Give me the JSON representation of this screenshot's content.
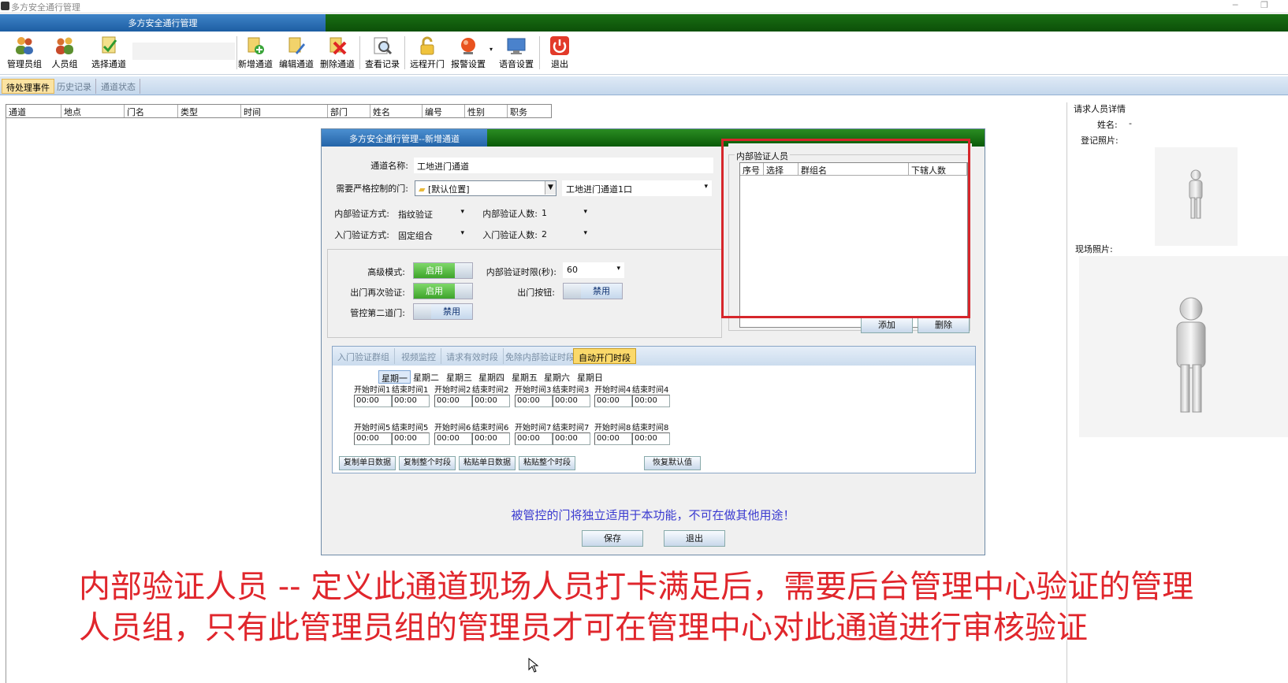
{
  "window": {
    "title": "多方安全通行管理",
    "banner_title": "多方安全通行管理"
  },
  "toolbar": {
    "items": [
      {
        "label": "管理员组",
        "icon": "admin-group-icon"
      },
      {
        "label": "人员组",
        "icon": "people-group-icon"
      },
      {
        "label": "选择通道",
        "icon": "select-channel-icon"
      },
      {
        "label": "新增通道",
        "icon": "add-channel-icon"
      },
      {
        "label": "编辑通道",
        "icon": "edit-channel-icon"
      },
      {
        "label": "删除通道",
        "icon": "delete-channel-icon"
      },
      {
        "label": "查看记录",
        "icon": "view-records-icon"
      },
      {
        "label": "远程开门",
        "icon": "remote-open-icon"
      },
      {
        "label": "报警设置",
        "icon": "alarm-settings-icon"
      },
      {
        "label": "语音设置",
        "icon": "voice-settings-icon"
      },
      {
        "label": "退出",
        "icon": "power-icon"
      }
    ]
  },
  "main_tabs": [
    "待处理事件",
    "历史记录",
    "通道状态"
  ],
  "grid": {
    "columns": [
      "通道",
      "地点",
      "门名",
      "类型",
      "时间",
      "部门",
      "姓名",
      "编号",
      "性别",
      "职务"
    ]
  },
  "right_panel": {
    "title": "请求人员详情",
    "name_label": "姓名:",
    "name_value": "-",
    "reg_photo_label": "登记照片:",
    "scene_photo_label": "现场照片:"
  },
  "dialog": {
    "title": "多方安全通行管理--新增通道",
    "channel_name_label": "通道名称:",
    "channel_name_value": "工地进门通道",
    "door_label": "需要严格控制的门:",
    "door_location": "[默认位置]",
    "door_name": "工地进门通道1口",
    "internal_method_label": "内部验证方式:",
    "internal_method_value": "指纹验证",
    "internal_count_label": "内部验证人数:",
    "internal_count_value": "1",
    "entry_method_label": "入门验证方式:",
    "entry_method_value": "固定组合",
    "entry_count_label": "入门验证人数:",
    "entry_count_value": "2",
    "advanced_mode_label": "高级模式:",
    "advanced_mode_state": "启用",
    "exit_reverify_label": "出门再次验证:",
    "exit_reverify_state": "启用",
    "second_door_label": "管控第二道门:",
    "second_door_state": "禁用",
    "internal_timeout_label": "内部验证时限(秒):",
    "internal_timeout_value": "60",
    "exit_button_label": "出门按钮:",
    "exit_button_state": "禁用",
    "verifiers_group_label": "内部验证人员",
    "verifiers_columns": [
      "序号",
      "选择",
      "群组名",
      "下辖人数"
    ],
    "add_button": "添加",
    "delete_button": "删除",
    "inner_tabs": [
      "入门验证群组",
      "视频监控",
      "请求有效时段",
      "免除内部验证时段",
      "自动开门时段"
    ],
    "days": [
      "星期一",
      "星期二",
      "星期三",
      "星期四",
      "星期五",
      "星期六",
      "星期日"
    ],
    "time_rows": [
      {
        "labels": [
          "开始时间1",
          "结束时间1",
          "开始时间2",
          "结束时间2",
          "开始时间3",
          "结束时间3",
          "开始时间4",
          "结束时间4"
        ],
        "values": [
          "00:00",
          "00:00",
          "00:00",
          "00:00",
          "00:00",
          "00:00",
          "00:00",
          "00:00"
        ]
      },
      {
        "labels": [
          "开始时间5",
          "结束时间5",
          "开始时间6",
          "结束时间6",
          "开始时间7",
          "结束时间7",
          "开始时间8",
          "结束时间8"
        ],
        "values": [
          "00:00",
          "00:00",
          "00:00",
          "00:00",
          "00:00",
          "00:00",
          "00:00",
          "00:00"
        ]
      }
    ],
    "copy_day_button": "复制单日数据",
    "copy_all_button": "复制整个时段",
    "paste_day_button": "粘贴单日数据",
    "paste_all_button": "粘贴整个时段",
    "restore_default_button": "恢复默认值",
    "notice": "被管控的门将独立适用于本功能，不可在做其他用途！",
    "save_button": "保存",
    "exit_button": "退出"
  },
  "caption": {
    "line1": "内部验证人员 -- 定义此通道现场人员打卡满足后，需要后台管理中心验证的管理",
    "line2": "人员组，只有此管理员组的管理员才可在管理中心对此通道进行审核验证"
  },
  "colors": {
    "banner_blue": "#2464a8",
    "banner_green": "#0b5a08",
    "highlight_red": "#d6262b",
    "caption_red": "#e0262c",
    "toggle_green": "#3da42a"
  }
}
